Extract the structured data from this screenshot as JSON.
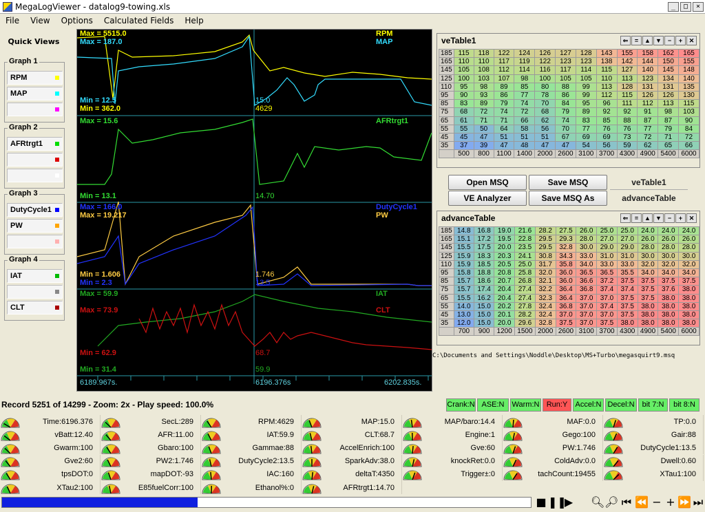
{
  "window": {
    "title": "MegaLogViewer - datalog9-towing.xls",
    "min": "_",
    "max": "□",
    "close": "×"
  },
  "menu": [
    "File",
    "View",
    "Options",
    "Calculated Fields",
    "Help"
  ],
  "quick_views": {
    "title": "Quick Views",
    "graphs": [
      {
        "name": "Graph 1",
        "slots": [
          {
            "label": "RPM",
            "color": "#ffff00"
          },
          {
            "label": "MAP",
            "color": "#00ffff"
          },
          {
            "label": "",
            "color": "#ff00ff"
          }
        ]
      },
      {
        "name": "Graph 2",
        "slots": [
          {
            "label": "AFRtrgt1",
            "color": "#00dd00"
          },
          {
            "label": "",
            "color": "#dd0000"
          },
          {
            "label": "",
            "color": "#ffffff"
          }
        ]
      },
      {
        "name": "Graph 3",
        "slots": [
          {
            "label": "DutyCycle1",
            "color": "#0000ff"
          },
          {
            "label": "PW",
            "color": "#ffa500"
          },
          {
            "label": "",
            "color": "#ffb0b0"
          }
        ]
      },
      {
        "name": "Graph 4",
        "slots": [
          {
            "label": "IAT",
            "color": "#00bb00"
          },
          {
            "label": "",
            "color": "#888888"
          },
          {
            "label": "CLT",
            "color": "#aa0000"
          }
        ]
      }
    ]
  },
  "graph_labels": {
    "g1": {
      "max_rpm": "Max = 5515.0",
      "max_map": "Max = 187.0",
      "min_map": "Min = 12.5",
      "min_rpm": "Min = 362.0",
      "cur_map": "15.0",
      "cur_rpm": "4629",
      "name_rpm": "RPM",
      "name_map": "MAP"
    },
    "g2": {
      "max": "Max = 15.6",
      "min": "Min = 13.1",
      "cur": "14.70",
      "name": "AFRtrgt1"
    },
    "g3": {
      "max_dc": "Max = 166.0",
      "max_pw": "Max = 19.217",
      "min_pw": "Min = 1.606",
      "min_dc": "Min = 2.3",
      "cur_pw": "1.746",
      "cur_dc": "13.5",
      "name_dc": "DutyCycle1",
      "name_pw": "PW"
    },
    "g4": {
      "max_iat": "Max = 59.9",
      "max_clt": "Max = 73.9",
      "min_clt": "Min = 62.9",
      "min_iat": "Min = 31.4",
      "cur_clt": "68.7",
      "cur_iat": "59.9",
      "name_iat": "IAT",
      "name_clt": "CLT"
    },
    "time_start": "6189.967s.",
    "time_cur": "6196.376s",
    "time_end": "6202.835s."
  },
  "colors": {
    "rpm": "#ffff00",
    "map": "#33ddff",
    "afr": "#33dd33",
    "duty": "#2233ff",
    "pw": "#ffcc44",
    "iat": "#22aa22",
    "clt": "#cc1111"
  },
  "ve_table": {
    "title": "veTable1",
    "rows": [
      "185",
      "165",
      "145",
      "125",
      "110",
      "95",
      "85",
      "75",
      "65",
      "55",
      "45",
      "35"
    ],
    "cols": [
      "500",
      "800",
      "1100",
      "1400",
      "2000",
      "2600",
      "3100",
      "3700",
      "4300",
      "4900",
      "5400",
      "6000"
    ],
    "values": [
      [
        "115",
        "118",
        "122",
        "124",
        "126",
        "127",
        "128",
        "143",
        "155",
        "158",
        "162",
        "165"
      ],
      [
        "110",
        "110",
        "117",
        "119",
        "122",
        "123",
        "123",
        "138",
        "142",
        "144",
        "150",
        "155"
      ],
      [
        "105",
        "108",
        "112",
        "114",
        "116",
        "117",
        "114",
        "115",
        "127",
        "140",
        "145",
        "148"
      ],
      [
        "100",
        "103",
        "107",
        "98",
        "100",
        "105",
        "105",
        "110",
        "113",
        "123",
        "134",
        "140"
      ],
      [
        "95",
        "98",
        "89",
        "85",
        "80",
        "88",
        "99",
        "113",
        "128",
        "131",
        "131",
        "135"
      ],
      [
        "90",
        "93",
        "86",
        "77",
        "78",
        "86",
        "99",
        "112",
        "115",
        "126",
        "126",
        "130"
      ],
      [
        "83",
        "89",
        "79",
        "74",
        "70",
        "84",
        "95",
        "96",
        "111",
        "112",
        "113",
        "115"
      ],
      [
        "68",
        "72",
        "74",
        "72",
        "68",
        "79",
        "89",
        "92",
        "92",
        "91",
        "98",
        "103"
      ],
      [
        "61",
        "71",
        "71",
        "66",
        "62",
        "74",
        "83",
        "85",
        "88",
        "87",
        "87",
        "90"
      ],
      [
        "55",
        "50",
        "64",
        "58",
        "56",
        "70",
        "77",
        "76",
        "76",
        "77",
        "79",
        "84"
      ],
      [
        "45",
        "47",
        "51",
        "51",
        "51",
        "67",
        "69",
        "69",
        "73",
        "72",
        "71",
        "72"
      ],
      [
        "37",
        "39",
        "47",
        "48",
        "47",
        "47",
        "54",
        "56",
        "59",
        "62",
        "65",
        "66"
      ]
    ]
  },
  "advance_table": {
    "title": "advanceTable",
    "rows": [
      "185",
      "165",
      "145",
      "125",
      "110",
      "95",
      "85",
      "75",
      "65",
      "55",
      "45",
      "35"
    ],
    "cols": [
      "700",
      "900",
      "1200",
      "1500",
      "2000",
      "2600",
      "3100",
      "3700",
      "4300",
      "4900",
      "5400",
      "6000"
    ],
    "values": [
      [
        "14.8",
        "16.8",
        "19.0",
        "21.6",
        "28.2",
        "27.5",
        "26.0",
        "25.0",
        "25.0",
        "24.0",
        "24.0",
        "24.0"
      ],
      [
        "15.1",
        "17.2",
        "19.5",
        "22.8",
        "29.5",
        "29.3",
        "28.0",
        "27.0",
        "27.0",
        "26.0",
        "26.0",
        "26.0"
      ],
      [
        "15.5",
        "17.5",
        "20.0",
        "23.5",
        "29.5",
        "32.8",
        "30.0",
        "29.0",
        "29.0",
        "28.0",
        "28.0",
        "28.0"
      ],
      [
        "15.9",
        "18.3",
        "20.3",
        "24.1",
        "30.8",
        "34.3",
        "33.0",
        "31.0",
        "31.0",
        "30.0",
        "30.0",
        "30.0"
      ],
      [
        "15.9",
        "18.5",
        "20.5",
        "25.0",
        "31.7",
        "35.8",
        "34.0",
        "33.0",
        "33.0",
        "32.0",
        "32.0",
        "32.0"
      ],
      [
        "15.8",
        "18.8",
        "20.8",
        "25.8",
        "32.0",
        "36.0",
        "36.5",
        "36.5",
        "35.5",
        "34.0",
        "34.0",
        "34.0"
      ],
      [
        "15.7",
        "18.6",
        "20.7",
        "26.8",
        "32.1",
        "36.0",
        "36.6",
        "37.2",
        "37.5",
        "37.5",
        "37.5",
        "37.5"
      ],
      [
        "15.7",
        "17.4",
        "20.4",
        "27.4",
        "32.2",
        "36.4",
        "36.8",
        "37.4",
        "37.4",
        "37.5",
        "37.6",
        "38.0"
      ],
      [
        "15.5",
        "16.2",
        "20.4",
        "27.4",
        "32.3",
        "36.4",
        "37.0",
        "37.0",
        "37.5",
        "37.5",
        "38.0",
        "38.0"
      ],
      [
        "14.0",
        "15.0",
        "20.2",
        "27.8",
        "32.4",
        "36.8",
        "37.0",
        "37.4",
        "37.5",
        "38.0",
        "38.0",
        "38.0"
      ],
      [
        "13.0",
        "15.0",
        "20.1",
        "28.2",
        "32.4",
        "37.0",
        "37.0",
        "37.0",
        "37.5",
        "38.0",
        "38.0",
        "38.0"
      ],
      [
        "12.0",
        "15.0",
        "20.0",
        "29.6",
        "32.8",
        "37.5",
        "37.0",
        "37.5",
        "38.0",
        "38.0",
        "38.0",
        "38.0"
      ]
    ]
  },
  "buttons": {
    "open_msq": "Open MSQ",
    "save_msq": "Save MSQ",
    "ve_analyzer": "VE Analyzer",
    "save_msq_as": "Save MSQ As",
    "tab_ve": "veTable1",
    "tab_adv": "advanceTable"
  },
  "msq_path": "C:\\Documents and Settings\\Noddle\\Desktop\\MS+Turbo\\megasquirt9.msq",
  "record_text": "Record 5251 of 14299 - Zoom: 2x - Play speed: 100.0%",
  "status_flags": [
    {
      "label": "Crank:N",
      "color": "#66ee66"
    },
    {
      "label": "ASE:N",
      "color": "#66ee66"
    },
    {
      "label": "Warm:N",
      "color": "#66ee66"
    },
    {
      "label": "Run:Y",
      "color": "#ff5555"
    },
    {
      "label": "Accel:N",
      "color": "#66ee66"
    },
    {
      "label": "Decel:N",
      "color": "#66ee66"
    },
    {
      "label": "bit 7:N",
      "color": "#66ee66"
    },
    {
      "label": "bit 8:N",
      "color": "#66ee66"
    }
  ],
  "gauges": [
    [
      "Time:6196.376",
      "SecL:289",
      "RPM:4629",
      "MAP:15.0",
      "MAP/baro:14.4",
      "MAF:0.0",
      "TP:0.0"
    ],
    [
      "vBatt:12.40",
      "AFR:11.00",
      "IAT:59.9",
      "CLT:68.7",
      "Engine:1",
      "Gego:100",
      "Gair:88"
    ],
    [
      "Gwarm:100",
      "Gbaro:100",
      "Gammae:88",
      "AccelEnrich:100",
      "Gve:60",
      "PW:1.746",
      "DutyCycle1:13.5"
    ],
    [
      "Gve2:60",
      "PW2:1.746",
      "DutyCycle2:13.5",
      "SparkAdv:38.0",
      "knockRet:0.0",
      "ColdAdv:0.0",
      "Dwell:0.60"
    ],
    [
      "tpsDOT:0",
      "mapDOT:-93",
      "IAC:160",
      "deltaT:4350",
      "Trigger±:0",
      "tachCount:19455",
      "XTau1:100"
    ],
    [
      "XTau2:100",
      "E85fuelCorr:100",
      "Ethanol%:0",
      "AFRtrgt1:14.70"
    ]
  ],
  "playback": {
    "progress": 0.37
  }
}
